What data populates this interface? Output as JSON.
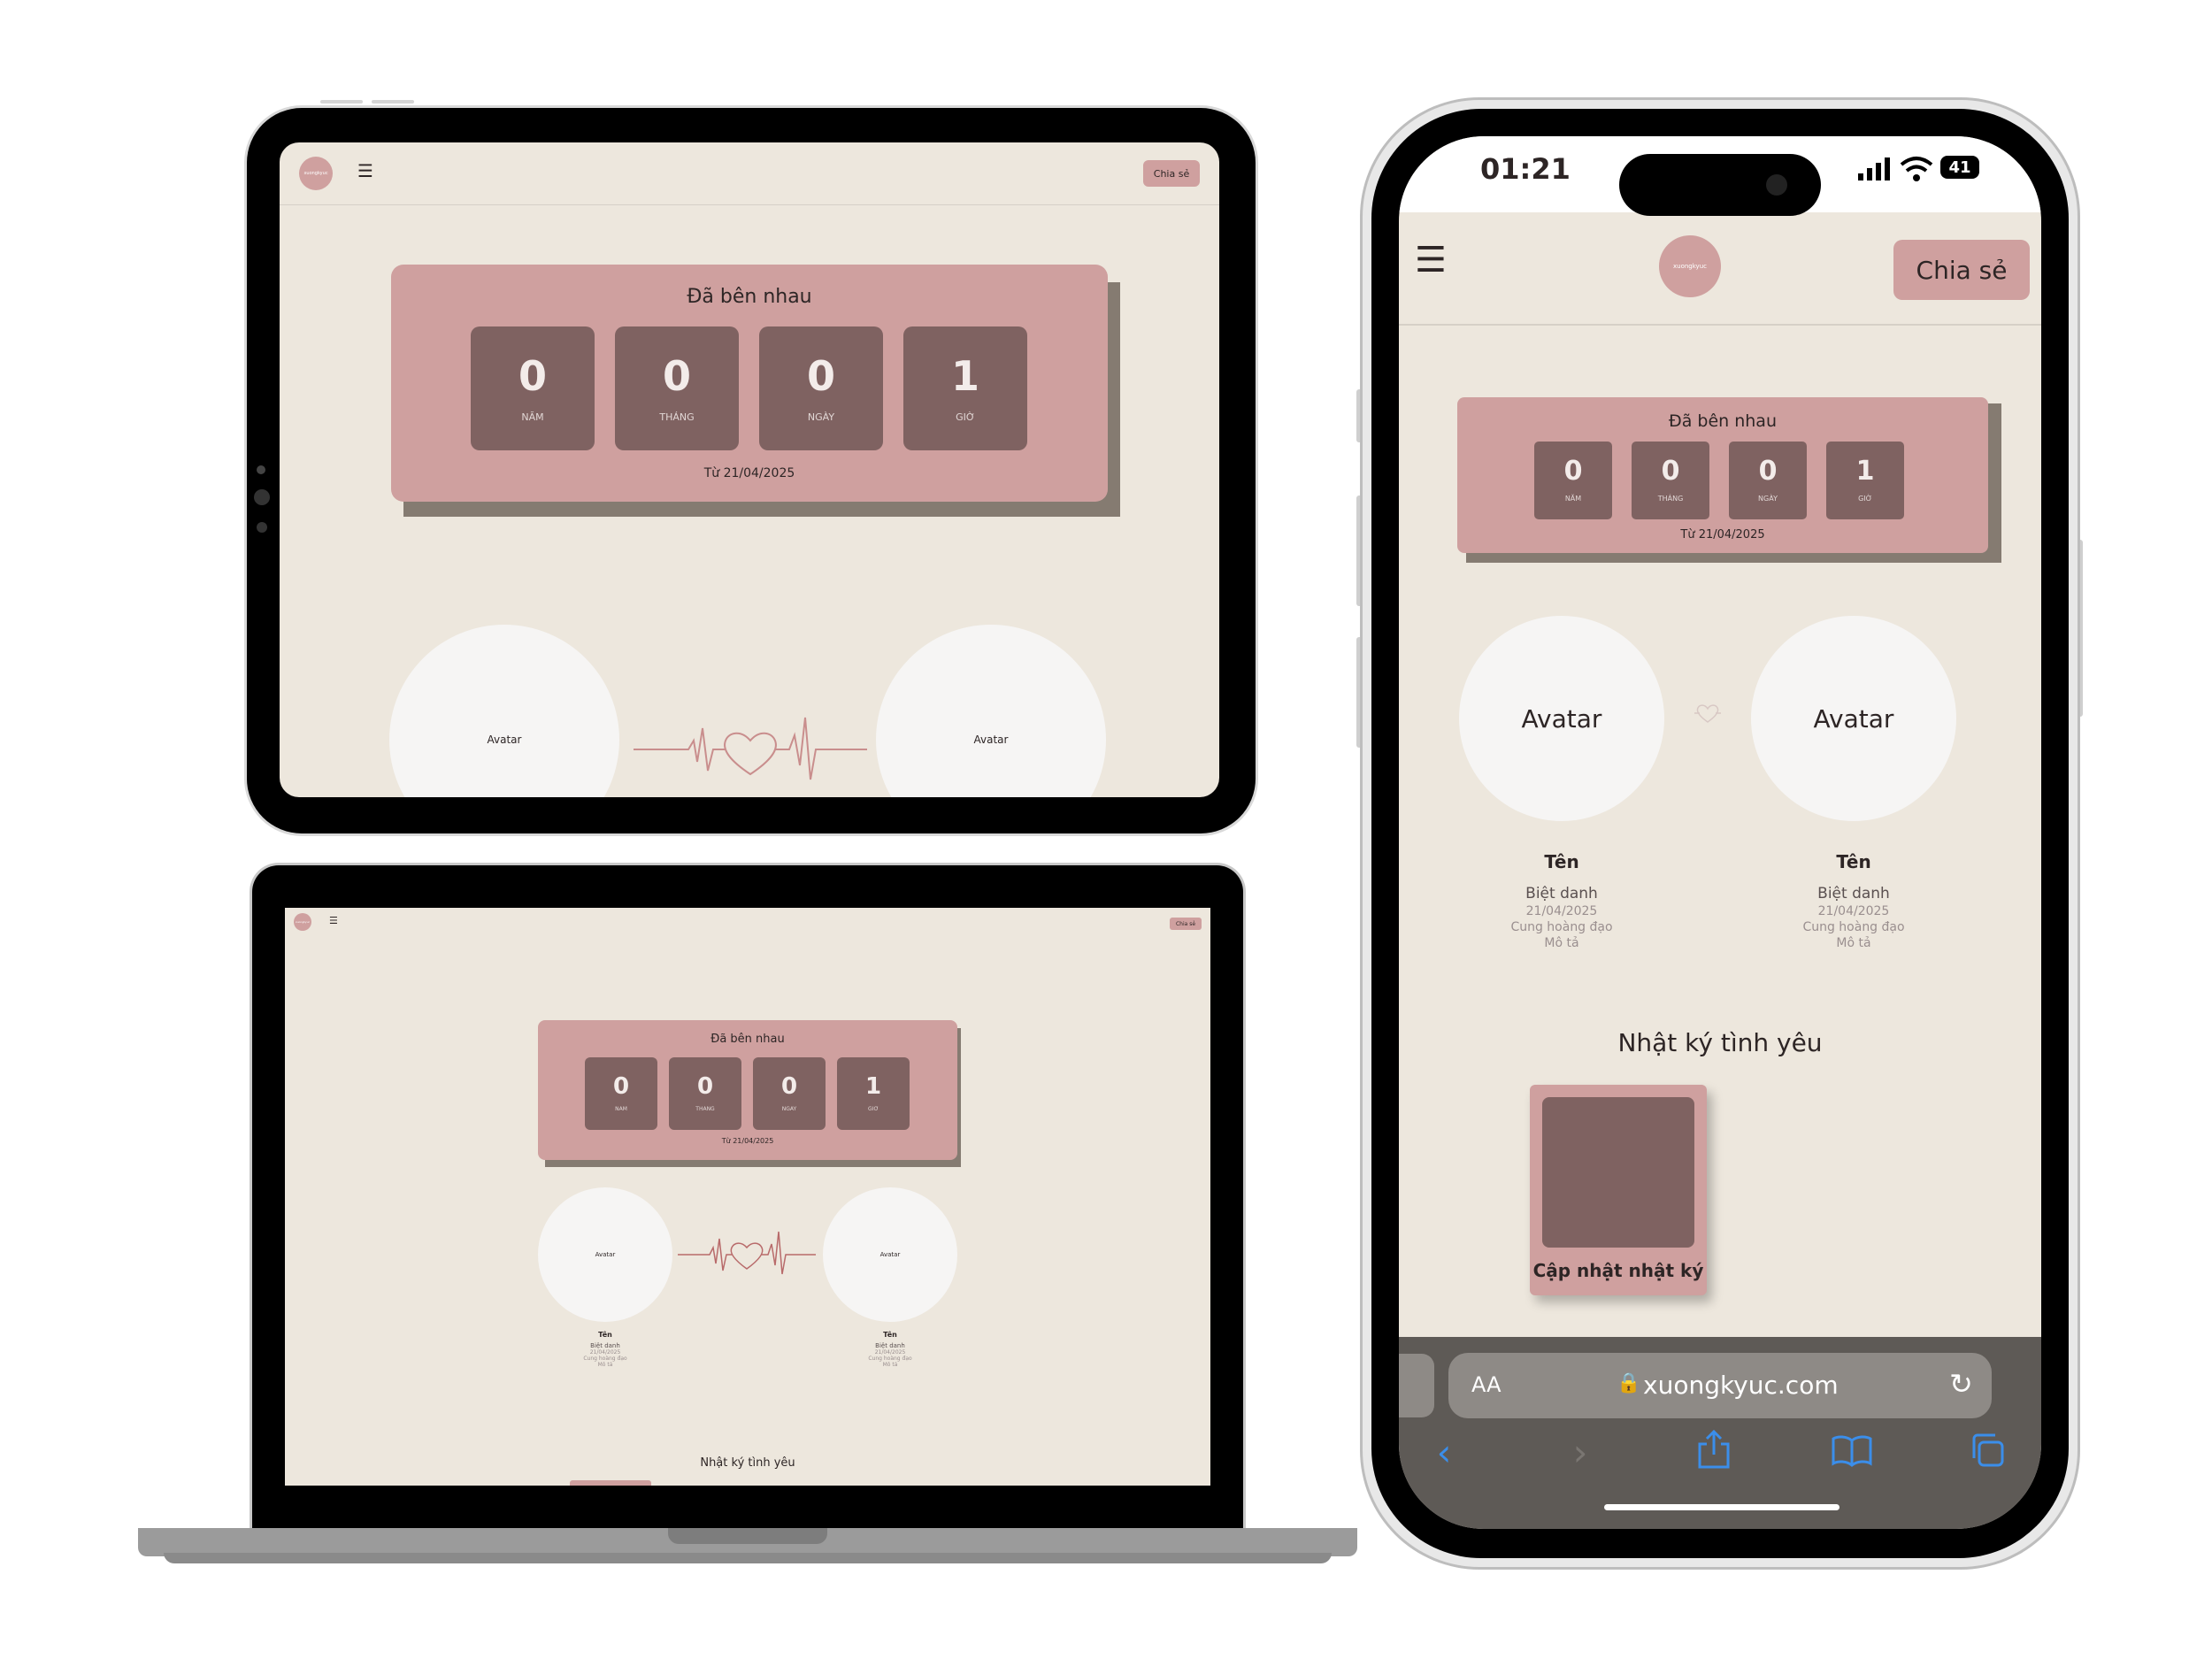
{
  "site": {
    "logo_text": "xuongkyuc",
    "share_label": "Chia sẻ",
    "menu_icon": "hamburger-icon",
    "counter": {
      "title": "Đã bên nhau",
      "units": [
        {
          "value": "0",
          "label": "NĂM"
        },
        {
          "value": "0",
          "label": "THÁNG"
        },
        {
          "value": "0",
          "label": "NGÀY"
        },
        {
          "value": "1",
          "label": "GIỜ"
        }
      ],
      "since": "Từ 21/04/2025"
    },
    "avatar_label": "Avatar",
    "person": {
      "name": "Tên",
      "nickname": "Biệt danh",
      "date": "21/04/2025",
      "zodiac": "Cung hoàng đạo",
      "description": "Mô tả"
    },
    "diary_title": "Nhật ký tình yêu",
    "diary_button": "Cập nhật nhật ký"
  },
  "phone": {
    "time": "01:21",
    "battery": "41",
    "url": "xuongkyuc.com",
    "text_size": "AA"
  },
  "colors": {
    "background": "#ede7dd",
    "accent": "#cfa09f",
    "tile": "#7f6261",
    "avatar": "#f6f5f4"
  }
}
